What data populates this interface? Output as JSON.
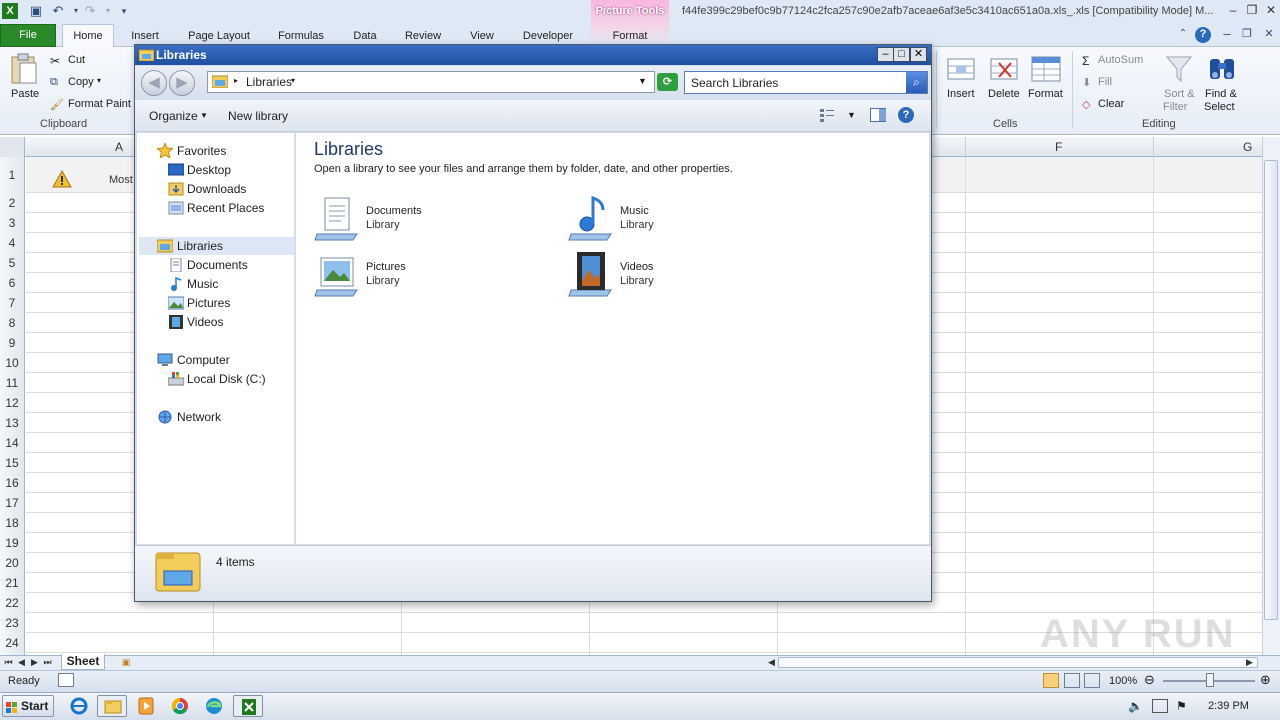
{
  "excel": {
    "title": "f44fe399c29bef0c9b77124c2fca257c90e2afb7aceae6af3e5c3410ac651a0a.xls_.xls [Compatibility Mode] M...",
    "picture_tools": "Picture Tools",
    "tabs": [
      "File",
      "Home",
      "Insert",
      "Page Layout",
      "Formulas",
      "Data",
      "Review",
      "View",
      "Developer",
      "Format"
    ],
    "clipboard": {
      "paste": "Paste",
      "cut": "Cut",
      "copy": "Copy",
      "format_paint": "Format Paint",
      "group": "Clipboard"
    },
    "cells": {
      "insert": "Insert",
      "delete": "Delete",
      "format": "Format",
      "group": "Cells"
    },
    "editing": {
      "autosum": "AutoSum",
      "fill": "Fill",
      "clear": "Clear",
      "sort": "Sort &",
      "filter": "Filter",
      "find": "Find &",
      "select": "Select",
      "group": "Editing"
    },
    "columns": [
      "A",
      "F",
      "G"
    ],
    "rows": [
      "1",
      "2",
      "3",
      "4",
      "5",
      "6",
      "7",
      "8",
      "9",
      "10",
      "11",
      "12",
      "13",
      "14",
      "15",
      "16",
      "17",
      "18",
      "19",
      "20",
      "21",
      "22",
      "23",
      "24"
    ],
    "cell_a1_text": "Most",
    "sheet_tab": "Sheet",
    "status": "Ready",
    "zoom": "100%"
  },
  "explorer": {
    "title": "Libraries",
    "address": "Libraries",
    "search_placeholder": "Search Libraries",
    "organize": "Organize",
    "new_library": "New library",
    "nav": {
      "favorites": "Favorites",
      "desktop": "Desktop",
      "downloads": "Downloads",
      "recent": "Recent Places",
      "libraries": "Libraries",
      "documents": "Documents",
      "music": "Music",
      "pictures": "Pictures",
      "videos": "Videos",
      "computer": "Computer",
      "local_disk": "Local Disk (C:)",
      "network": "Network"
    },
    "heading": "Libraries",
    "subheading": "Open a library to see your files and arrange them by folder, date, and other properties.",
    "libraries": [
      {
        "name": "Documents",
        "type": "Library"
      },
      {
        "name": "Music",
        "type": "Library"
      },
      {
        "name": "Pictures",
        "type": "Library"
      },
      {
        "name": "Videos",
        "type": "Library"
      }
    ],
    "item_count": "4 items"
  },
  "taskbar": {
    "start": "Start",
    "clock": "2:39 PM"
  },
  "watermark": "ANY RUN"
}
